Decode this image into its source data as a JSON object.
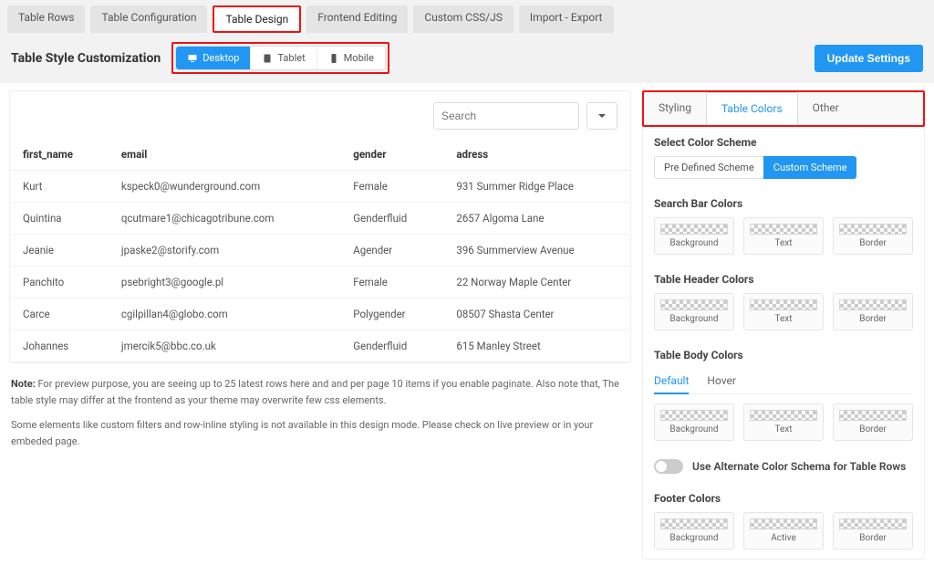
{
  "top_tabs": [
    "Table Rows",
    "Table Configuration",
    "Table Design",
    "Frontend Editing",
    "Custom CSS/JS",
    "Import - Export"
  ],
  "top_tabs_active": 2,
  "page_title": "Table Style Customization",
  "devices": [
    "Desktop",
    "Tablet",
    "Mobile"
  ],
  "devices_active": 0,
  "update_btn": "Update Settings",
  "search_placeholder": "Search",
  "columns": [
    "first_name",
    "email",
    "gender",
    "adress"
  ],
  "rows": [
    [
      "Kurt",
      "kspeck0@wunderground.com",
      "Female",
      "931 Summer Ridge Place"
    ],
    [
      "Quintina",
      "qcutmare1@chicagotribune.com",
      "Genderfluid",
      "2657 Algoma Lane"
    ],
    [
      "Jeanie",
      "jpaske2@storify.com",
      "Agender",
      "396 Summerview Avenue"
    ],
    [
      "Panchito",
      "psebright3@google.pl",
      "Female",
      "22 Norway Maple Center"
    ],
    [
      "Carce",
      "cgilpillan4@globo.com",
      "Polygender",
      "08507 Shasta Center"
    ],
    [
      "Johannes",
      "jmercik5@bbc.co.uk",
      "Genderfluid",
      "615 Manley Street"
    ]
  ],
  "note_label": "Note:",
  "note_1": " For preview purpose, you are seeing up to 25 latest rows here and and per page 10 items if you enable paginate. Also note that, The table style may differ at the frontend as your theme may overwrite few css elements.",
  "note_2": "Some elements like custom filters and row-inline styling is not available in this design mode. Please check on live preview or in your embeded page.",
  "right_tabs": [
    "Styling",
    "Table Colors",
    "Other"
  ],
  "right_tabs_active": 1,
  "scheme_label": "Select Color Scheme",
  "scheme_options": [
    "Pre Defined Scheme",
    "Custom Scheme"
  ],
  "scheme_active": 1,
  "groups": {
    "search": {
      "title": "Search Bar Colors",
      "items": [
        "Background",
        "Text",
        "Border"
      ]
    },
    "header": {
      "title": "Table Header Colors",
      "items": [
        "Background",
        "Text",
        "Border"
      ]
    },
    "body": {
      "title": "Table Body Colors",
      "subtabs": [
        "Default",
        "Hover"
      ],
      "sub_active": 0,
      "items": [
        "Background",
        "Text",
        "Border"
      ]
    },
    "footer": {
      "title": "Footer Colors",
      "items": [
        "Background",
        "Active",
        "Border"
      ]
    }
  },
  "alternate_toggle": "Use Alternate Color Schema for Table Rows"
}
